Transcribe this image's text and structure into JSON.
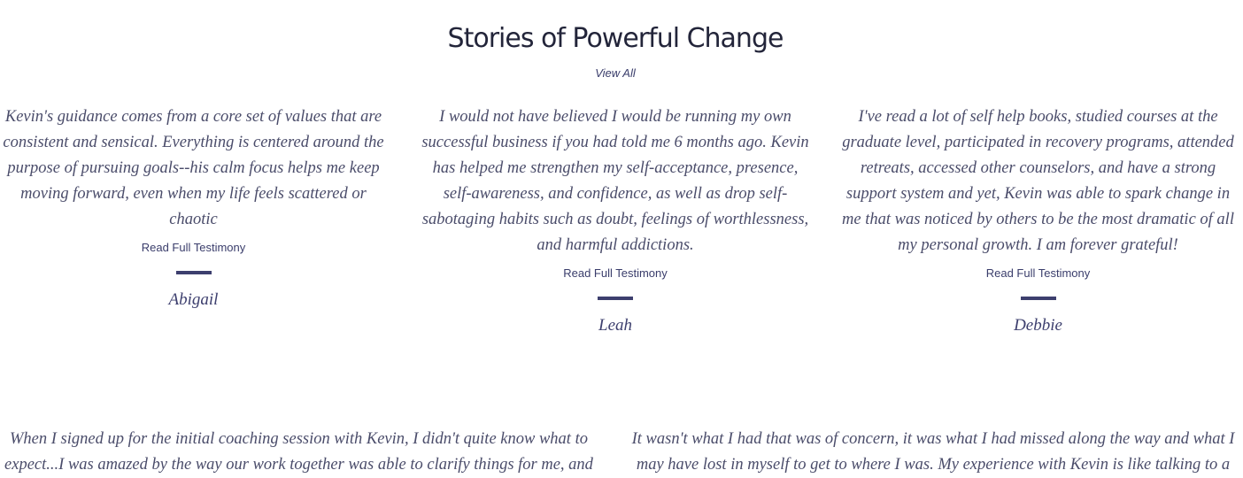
{
  "section": {
    "title": "Stories of Powerful Change",
    "view_all": "View All"
  },
  "testimonials_row1": [
    {
      "quote": "Kevin's guidance comes from a core set of values that are consistent and sensical. Everything is centered around the purpose of pursuing goals--his calm focus helps me keep moving forward, even when my life feels scattered or chaotic",
      "read_full": "Read Full Testimony",
      "name": "Abigail"
    },
    {
      "quote": "I would not have believed I would be running my own successful business if you had told me 6 months ago. Kevin has helped me strengthen my self-acceptance, presence, self-awareness, and confidence, as well as drop self-sabotaging habits such as doubt, feelings of worthlessness, and harmful addictions.",
      "read_full": "Read Full Testimony",
      "name": "Leah"
    },
    {
      "quote": "I've read a lot of self help books, studied courses at the graduate level, participated in recovery programs, attended retreats, accessed other counselors, and have a strong support system and yet, Kevin was able to spark change in me that was noticed by others to be the most dramatic of all my personal growth. I am forever grateful!",
      "read_full": "Read Full Testimony",
      "name": "Debbie"
    }
  ],
  "testimonials_row2": [
    {
      "quote": "When I signed up for the initial coaching session with Kevin, I didn't quite know what to expect...I was amazed by the way our work together was able to clarify things for me, and"
    },
    {
      "quote": "It wasn't what I had that was of concern, it was what I had missed along the way and what I may have lost in myself to get to where I was. My experience with Kevin is like talking to a"
    }
  ]
}
